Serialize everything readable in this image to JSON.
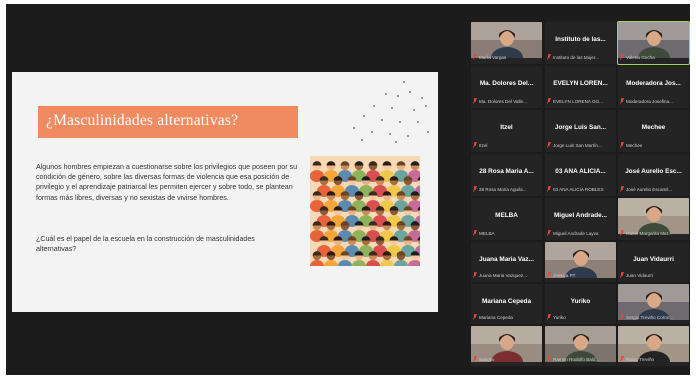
{
  "slide": {
    "title": "¿Masculinidades alternativas?",
    "body": "Algunos hombres empiezan a cuestionarse sobre los privilegios que poseen por su condición de género, sobre las diversas formas de violencia que esa posición de privilegio y el aprendizaje patriarcal les permiten ejercer y sobre todo, se plantean formas más libres, diversas y no sexistas de vivirse hombres.",
    "question": "¿Cuál es el papel de la escuela en la construcción de masculinidades alternativas?"
  },
  "colors": {
    "title_band": "#f08a60",
    "active_speaker": "#a4d65e",
    "muted_mic": "#e04a3c"
  },
  "participants": [
    {
      "display": "",
      "label": "María Vargas",
      "video": true
    },
    {
      "display": "Instituto de las...",
      "label": "Instituto de las Mujer...",
      "video": false
    },
    {
      "display": "",
      "label": "Valeria Gocha",
      "video": true,
      "active": true
    },
    {
      "display": "Ma. Dolores Del...",
      "label": "Ma. Dolores Del Valle...",
      "video": false
    },
    {
      "display": "EVELYN LOREN...",
      "label": "EVELYN LORENA GO...",
      "video": false
    },
    {
      "display": "Moderadora Jos...",
      "label": "Moderadora Josefina...",
      "video": false
    },
    {
      "display": "Itzel",
      "label": "Itzel",
      "video": false
    },
    {
      "display": "Jorge Luis San...",
      "label": "Jorge Luis San Martín...",
      "video": false
    },
    {
      "display": "Mechee",
      "label": "Mechee",
      "video": false
    },
    {
      "display": "28 Rosa Maria A...",
      "label": "28 Rosa Maria Aguila...",
      "video": false
    },
    {
      "display": "03 ANA ALICIA...",
      "label": "03 ANA ALICIA ROBLES",
      "video": false
    },
    {
      "display": "José Aurelio Esc...",
      "label": "José Aurelio Escamil...",
      "video": false
    },
    {
      "display": "MELBA",
      "label": "MELBA",
      "video": false
    },
    {
      "display": "Miguel Andrade...",
      "label": "Miguel Andrade Layva",
      "video": false
    },
    {
      "display": "",
      "label": "Isabel Margarita Mat...",
      "video": true
    },
    {
      "display": "Juana Maria Vaz...",
      "label": "Juana Maria Vazquez...",
      "video": false
    },
    {
      "display": "",
      "label": "Jessica PT",
      "video": true
    },
    {
      "display": "Juan Vidaurri",
      "label": "Juan Vidaurri",
      "video": false
    },
    {
      "display": "Mariana Cepeda",
      "label": "Mariana Cepeda",
      "video": false
    },
    {
      "display": "Yuriko",
      "label": "Yuriko",
      "video": false
    },
    {
      "display": "",
      "label": "Sergio Treviño Coron...",
      "video": true
    },
    {
      "display": "",
      "label": "Sandra",
      "video": true
    },
    {
      "display": "",
      "label": "Ramón Rodolfo Bald...",
      "video": true
    },
    {
      "display": "",
      "label": "Rocio Treviño",
      "video": true
    }
  ]
}
